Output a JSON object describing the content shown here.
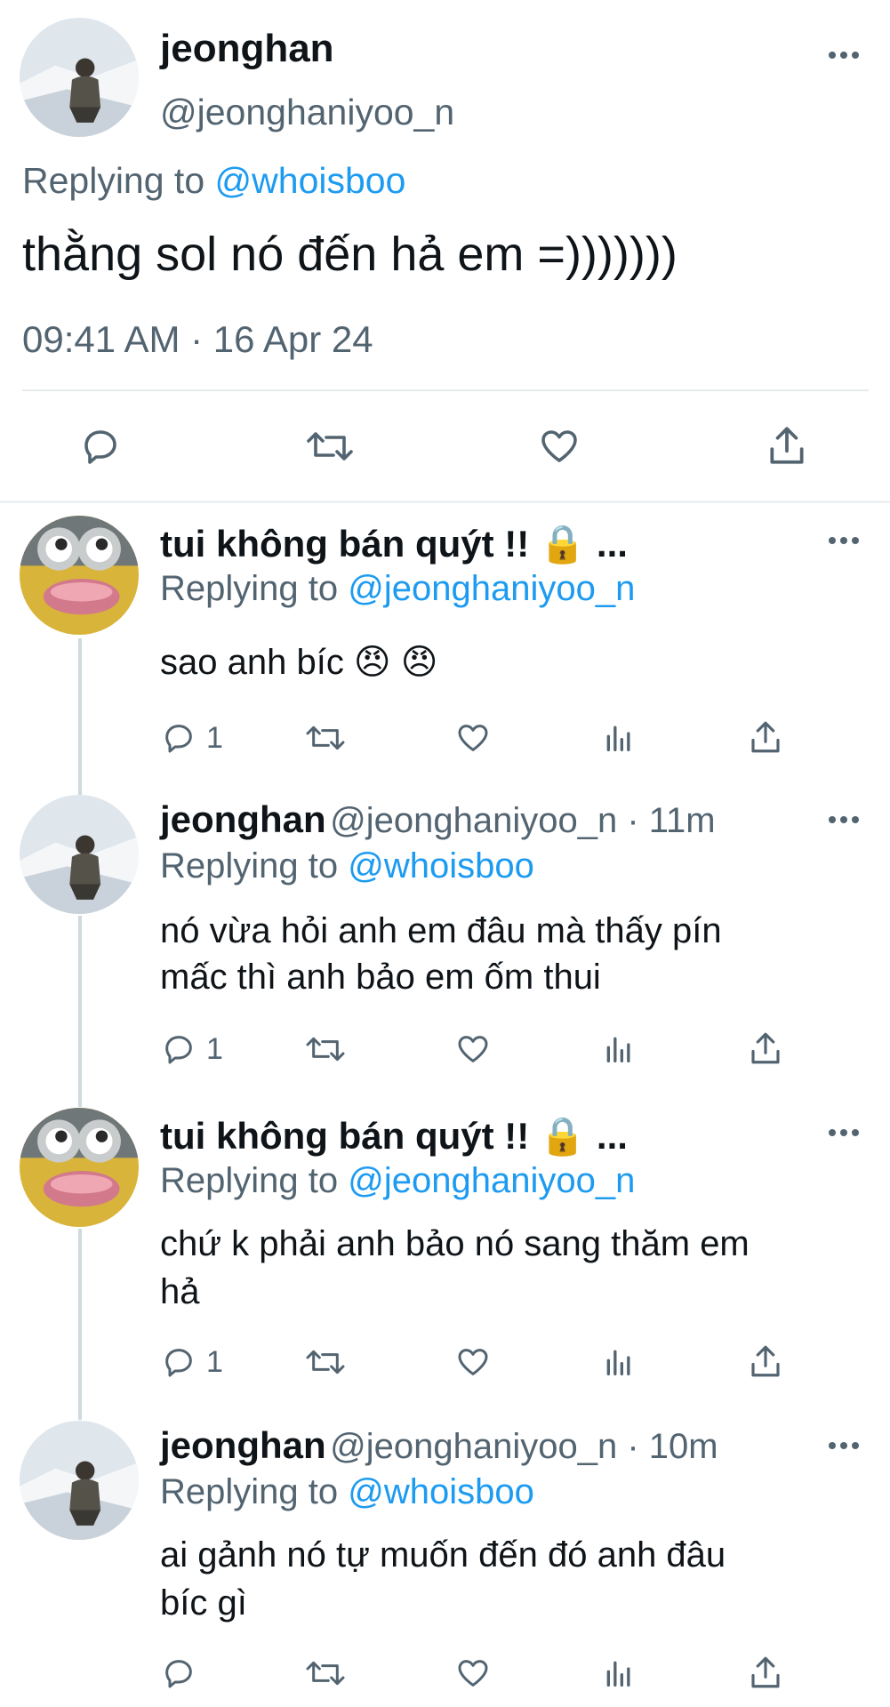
{
  "main_tweet": {
    "name": "jeonghan",
    "handle": "@jeonghaniyoo_n",
    "replying_label": "Replying to",
    "replying_to": "@whoisboo",
    "text": "thằng sol nó đến hả em =)))))))",
    "timestamp": "09:41 AM · 16 Apr 24"
  },
  "replies": [
    {
      "name": "tui không bán quýt !! 🔒 ...",
      "replying_label": "Replying to",
      "replying_to": "@jeonghaniyoo_n",
      "text": "sao anh bíc 😠 😠",
      "reply_count": "1"
    },
    {
      "name": "jeonghan",
      "handle_time": "@jeonghaniyoo_n · 11m",
      "replying_label": "Replying to",
      "replying_to": "@whoisboo",
      "text_line1": "nó vừa hỏi anh em đâu mà thấy pín",
      "text_line2": "mấc thì anh bảo em ốm thui",
      "reply_count": "1"
    },
    {
      "name": "tui không bán quýt !! 🔒 ...",
      "replying_label": "Replying to",
      "replying_to": "@jeonghaniyoo_n",
      "text_line1": "chứ k phải anh bảo nó sang thăm em",
      "text_line2": "hả",
      "reply_count": "1"
    },
    {
      "name": "jeonghan",
      "handle_time": "@jeonghaniyoo_n · 10m",
      "replying_label": "Replying to",
      "replying_to": "@whoisboo",
      "text_line1": "ai gảnh nó tự muốn đến đó anh đâu",
      "text_line2": "bíc gì"
    }
  ],
  "icons": {
    "reply": "speech-bubble-icon",
    "retweet": "retweet-arrows-icon",
    "like": "heart-outline-icon",
    "views": "bar-chart-icon",
    "share": "share-upload-icon",
    "more": "ellipsis-icon"
  },
  "colors": {
    "link": "#1d9bf0",
    "secondary_text": "#536471",
    "primary_text": "#0f1419",
    "thread_line": "#cfd9de"
  }
}
